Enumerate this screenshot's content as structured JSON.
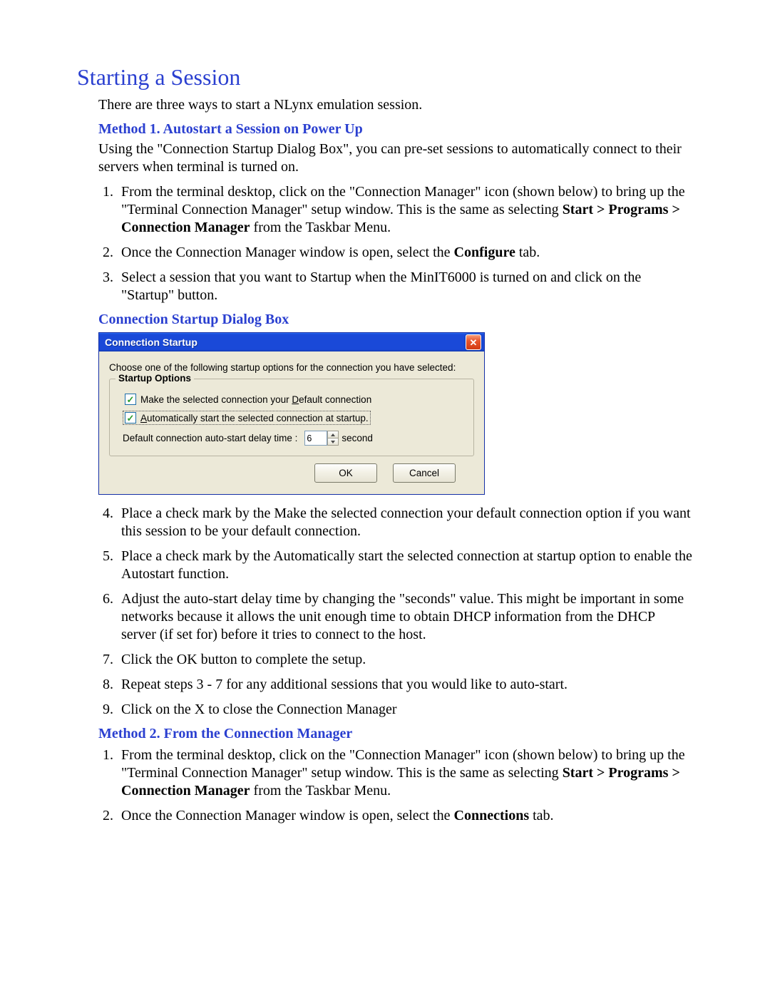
{
  "title": "Starting a Session",
  "intro": "There are three ways to start a NLynx emulation session.",
  "method1": {
    "heading": "Method 1.  Autostart a Session on Power Up",
    "desc": "Using the \"Connection Startup Dialog Box\", you can pre-set sessions to automatically connect to their servers when terminal is turned on.",
    "step1_pre": "From the terminal desktop, click on the \"Connection Manager\" icon (shown below) to bring up the \"Terminal Connection Manager\" setup window.  This is the same as selecting ",
    "step1_bold": "Start > Programs > Connection Manager",
    "step1_post": " from the Taskbar Menu.",
    "step2_pre": "Once the Connection Manager window is open, select the ",
    "step2_bold": "Configure",
    "step2_post": " tab.",
    "step3": "Select a session that you want to Startup when the MinIT6000 is turned on and click on the \"Startup\" button."
  },
  "dialog_caption": "Connection Startup Dialog Box",
  "dialog": {
    "title": "Connection Startup",
    "instruction": "Choose one of the following startup options for the connection you have selected:",
    "group_title": "Startup Options",
    "chk1_pre": "Make the selected connection your ",
    "chk1_ul": "D",
    "chk1_post": "efault connection",
    "chk2_ul": "A",
    "chk2_post": "utomatically start the selected connection at startup.",
    "delay_label": "Default connection auto-start delay time :",
    "delay_value": "6",
    "delay_unit": "second",
    "ok": "OK",
    "cancel": "Cancel"
  },
  "steps_after": {
    "s4": "Place a check mark by the Make the selected connection your default connection option if you want this session to be your default connection.",
    "s5": "Place a check mark by the Automatically start the selected connection at startup option to enable the Autostart function.",
    "s6": "Adjust the auto-start delay time by changing the \"seconds\" value.  This might be important in some networks because it allows the unit enough time to obtain DHCP information from the DHCP server (if set for) before it tries to connect to the host.",
    "s7": "Click the OK button to complete the setup.",
    "s8": "Repeat steps 3 - 7 for any additional sessions that you would like to auto-start.",
    "s9": "Click on the X to close the Connection Manager"
  },
  "method2": {
    "heading": "Method 2.  From the Connection Manager",
    "step1_pre": "From the terminal desktop, click on the \"Connection Manager\" icon (shown below) to bring up the \"Terminal Connection Manager\" setup window.  This is the same as selecting ",
    "step1_bold": "Start > Programs > Connection Manager",
    "step1_post": " from the Taskbar Menu.",
    "step2_pre": "Once the Connection Manager window is open, select the ",
    "step2_bold": "Connections",
    "step2_post": " tab."
  }
}
